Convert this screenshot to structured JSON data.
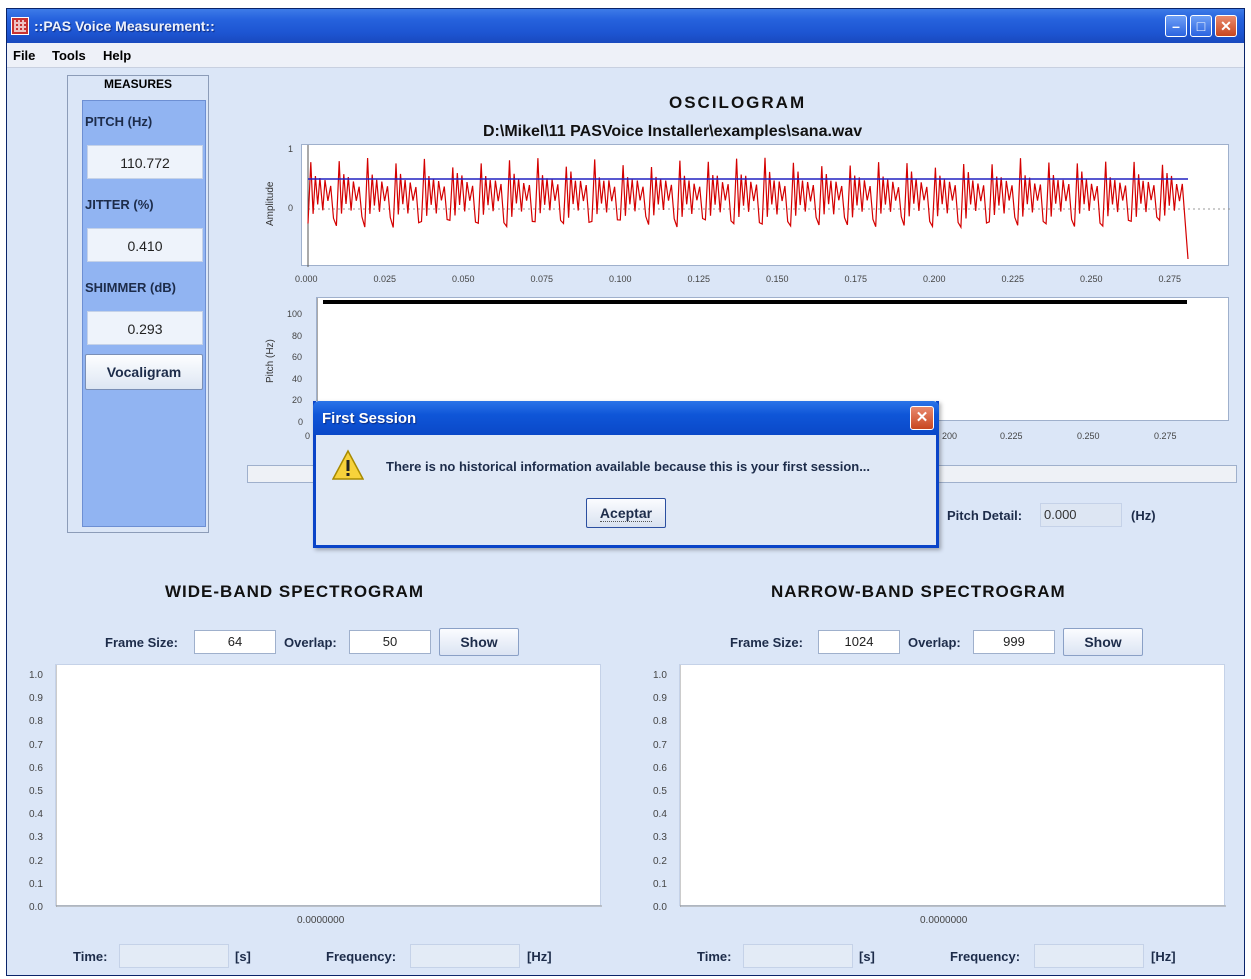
{
  "window": {
    "title": "::PAS Voice Measurement::"
  },
  "menu": [
    "File",
    "Tools",
    "Help"
  ],
  "measures": {
    "title": "MEASURES",
    "pitch_label": "PITCH (Hz)",
    "pitch_value": "110.772",
    "jitter_label": "JITTER (%)",
    "jitter_value": "0.410",
    "shimmer_label": "SHIMMER (dB)",
    "shimmer_value": "0.293",
    "vocaligram_button": "Vocaligram"
  },
  "oscilogram": {
    "title": "OSCILOGRAM",
    "path": "D:\\Mikel\\11 PASVoice Installer\\examples\\sana.wav",
    "amp_ylabel": "Amplitude",
    "amp_yticks": [
      "1",
      "0"
    ],
    "xticks": [
      "0.000",
      "0.025",
      "0.050",
      "0.075",
      "0.100",
      "0.125",
      "0.150",
      "0.175",
      "0.200",
      "0.225",
      "0.250",
      "0.275"
    ],
    "pitch_ylabel": "Pitch (Hz)",
    "pitch_yticks": [
      "100",
      "80",
      "60",
      "40",
      "20",
      "0"
    ],
    "pitch_xticks_visible": [
      "0",
      "200",
      "0.225",
      "0.250",
      "0.275"
    ],
    "pitch_detail_label": "Pitch Detail:",
    "pitch_detail_value": "0.000",
    "pitch_detail_unit": "(Hz)"
  },
  "wide_band": {
    "title": "WIDE-BAND SPECTROGRAM",
    "frame_size_label": "Frame Size:",
    "frame_size_value": "64",
    "overlap_label": "Overlap:",
    "overlap_value": "50",
    "show_button": "Show",
    "yticks": [
      "1.0",
      "0.9",
      "0.8",
      "0.7",
      "0.6",
      "0.5",
      "0.4",
      "0.3",
      "0.2",
      "0.1",
      "0.0"
    ],
    "xtick": "0.0000000",
    "time_label": "Time:",
    "time_unit": "[s]",
    "frequency_label": "Frequency:",
    "frequency_unit": "[Hz]"
  },
  "narrow_band": {
    "title": "NARROW-BAND SPECTROGRAM",
    "frame_size_label": "Frame Size:",
    "frame_size_value": "1024",
    "overlap_label": "Overlap:",
    "overlap_value": "999",
    "show_button": "Show",
    "yticks": [
      "1.0",
      "0.9",
      "0.8",
      "0.7",
      "0.6",
      "0.5",
      "0.4",
      "0.3",
      "0.2",
      "0.1",
      "0.0"
    ],
    "xtick": "0.0000000",
    "time_label": "Time:",
    "time_unit": "[s]",
    "frequency_label": "Frequency:",
    "frequency_unit": "[Hz]"
  },
  "dialog": {
    "title": "First Session",
    "message": "There is no historical information available because this is your first session...",
    "button": "Aceptar"
  },
  "colors": {
    "waveform": "#d40000",
    "threshold_line": "#2020c0",
    "pitch_line": "#000000",
    "measures_panel": "#91b4f2",
    "titlebar": "#1d55d2"
  },
  "icons": {
    "dialog": "warning-icon",
    "app": "app-icon"
  }
}
